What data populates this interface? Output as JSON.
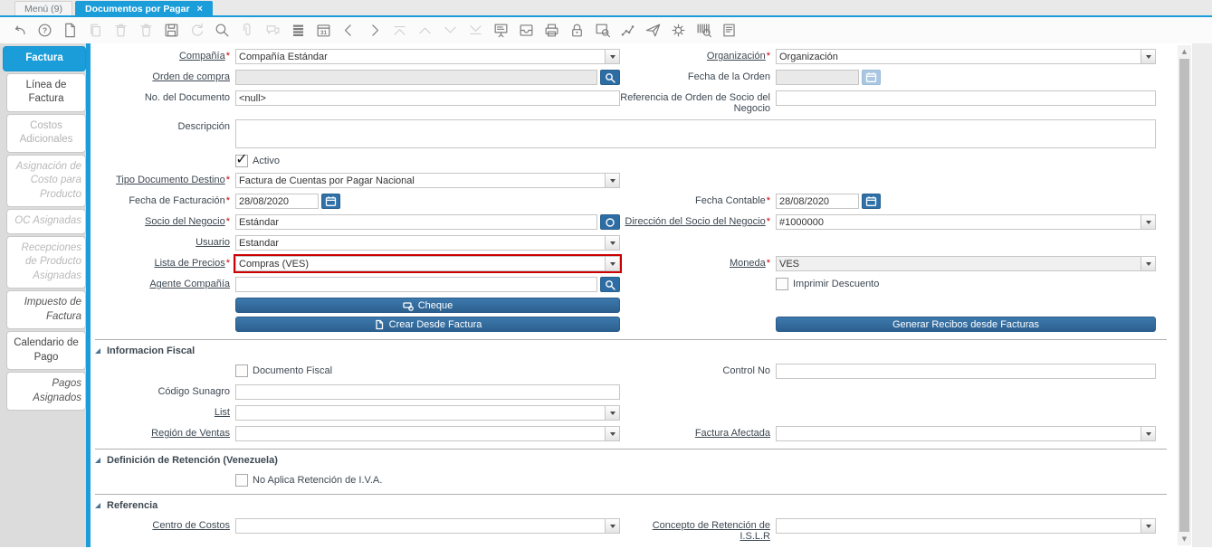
{
  "window": {
    "tabs": [
      {
        "label": "Menú (9)",
        "active": false
      },
      {
        "label": "Documentos por Pagar",
        "active": true
      }
    ]
  },
  "icons": {
    "close": "×",
    "check": "✓",
    "scroll_up": "▲",
    "scroll_down": "▼",
    "help_glyph": "?"
  },
  "toolbar": {
    "calendar_day": "31",
    "icons": [
      {
        "name": "undo",
        "disabled": false
      },
      {
        "name": "help",
        "disabled": false
      },
      {
        "name": "new-record",
        "disabled": false
      },
      {
        "name": "copy-record",
        "disabled": true
      },
      {
        "name": "delete-record",
        "disabled": true
      },
      {
        "name": "delete-selection",
        "disabled": true
      },
      {
        "name": "save",
        "disabled": false
      },
      {
        "name": "refresh",
        "disabled": true
      },
      {
        "name": "find",
        "disabled": false
      },
      {
        "name": "attachment",
        "disabled": true
      },
      {
        "name": "chat",
        "disabled": true
      },
      {
        "name": "grid-toggle",
        "disabled": false
      },
      {
        "name": "calendar",
        "disabled": false
      },
      {
        "name": "previous-record",
        "disabled": false
      },
      {
        "name": "next-record",
        "disabled": false
      },
      {
        "name": "parent-record",
        "disabled": true
      },
      {
        "name": "up",
        "disabled": true
      },
      {
        "name": "down",
        "disabled": true
      },
      {
        "name": "detail-record",
        "disabled": true
      },
      {
        "name": "report",
        "disabled": false
      },
      {
        "name": "archive",
        "disabled": false
      },
      {
        "name": "print",
        "disabled": false
      },
      {
        "name": "lock",
        "disabled": false
      },
      {
        "name": "print-preview",
        "disabled": false
      },
      {
        "name": "workflow",
        "disabled": false
      },
      {
        "name": "send-mail",
        "disabled": false
      },
      {
        "name": "preferences",
        "disabled": false
      },
      {
        "name": "barcode-search",
        "disabled": false
      },
      {
        "name": "document-report",
        "disabled": false
      }
    ]
  },
  "sidebar": {
    "tabs": [
      {
        "label": "Factura",
        "state": "active"
      },
      {
        "label": "Línea de Factura",
        "state": "normal"
      },
      {
        "label": "Costos Adicionales",
        "state": "disabled"
      },
      {
        "label": "Asignación de Costo para Producto",
        "state": "disabled-italic"
      },
      {
        "label": "OC Asignadas",
        "state": "disabled-italic"
      },
      {
        "label": "Recepciones de Producto Asignadas",
        "state": "disabled-italic"
      },
      {
        "label": "Impuesto de Factura",
        "state": "italic"
      },
      {
        "label": "Calendario de Pago",
        "state": "normal"
      },
      {
        "label": "Pagos Asignados",
        "state": "italic"
      }
    ]
  },
  "fields": {
    "compania": {
      "label": "Compañía",
      "value": "Compañía Estándar",
      "required": true
    },
    "organizacion": {
      "label": "Organización",
      "value": "Organización",
      "required": true
    },
    "orden_de_compra": {
      "label": "Orden de compra",
      "value": ""
    },
    "fecha_de_la_orden": {
      "label": "Fecha de la Orden",
      "value": ""
    },
    "no_del_documento": {
      "label": "No. del Documento",
      "value": "<null>"
    },
    "referencia_orden": {
      "label": "Referencia de Orden de Socio del Negocio",
      "value": ""
    },
    "descripcion": {
      "label": "Descripción",
      "value": ""
    },
    "activo": {
      "label": "Activo",
      "checked": true
    },
    "tipo_documento_destino": {
      "label": "Tipo Documento Destino",
      "value": "Factura de Cuentas por Pagar Nacional",
      "required": true
    },
    "fecha_facturacion": {
      "label": "Fecha de Facturación",
      "value": "28/08/2020",
      "required": true
    },
    "fecha_contable": {
      "label": "Fecha Contable",
      "value": "28/08/2020",
      "required": true
    },
    "socio_negocio": {
      "label": "Socio del Negocio",
      "value": "Estándar",
      "required": true
    },
    "direccion_socio": {
      "label": "Dirección del Socio del Negocio",
      "value": "#1000000",
      "required": true
    },
    "usuario": {
      "label": "Usuario",
      "value": "Estandar"
    },
    "lista_precios": {
      "label": "Lista de Precios",
      "value": "Compras (VES)",
      "required": true,
      "highlighted": true
    },
    "moneda": {
      "label": "Moneda",
      "value": "VES",
      "required": true
    },
    "agente_compania": {
      "label": "Agente Compañía",
      "value": ""
    },
    "imprimir_descuento": {
      "label": "Imprimir Descuento",
      "checked": false
    },
    "documento_fiscal": {
      "label": "Documento Fiscal",
      "checked": false
    },
    "control_no": {
      "label": "Control No",
      "value": ""
    },
    "codigo_sunagro": {
      "label": "Código Sunagro",
      "value": ""
    },
    "list": {
      "label": "List",
      "value": ""
    },
    "region_ventas": {
      "label": "Región de Ventas",
      "value": ""
    },
    "factura_afectada": {
      "label": "Factura Afectada",
      "value": ""
    },
    "no_aplica_retencion": {
      "label": "No Aplica Retención de I.V.A.",
      "checked": false
    },
    "centro_costos": {
      "label": "Centro de Costos",
      "value": ""
    },
    "concepto_islr": {
      "label": "Concepto de Retención de I.S.L.R",
      "value": ""
    }
  },
  "buttons": {
    "cheque": "Cheque",
    "crear_desde_factura": "Crear Desde Factura",
    "generar_recibos": "Generar Recibos desde Facturas"
  },
  "sections": {
    "informacion_fiscal": {
      "title": "Informacion Fiscal"
    },
    "retencion": {
      "title": "Definición de Retención (Venezuela)"
    },
    "referencia": {
      "title": "Referencia"
    }
  },
  "colors": {
    "accent_blue": "#1b9dd9",
    "button_blue": "#2e6da4",
    "required_red": "#cc0000",
    "highlight_red": "#cc0000"
  }
}
